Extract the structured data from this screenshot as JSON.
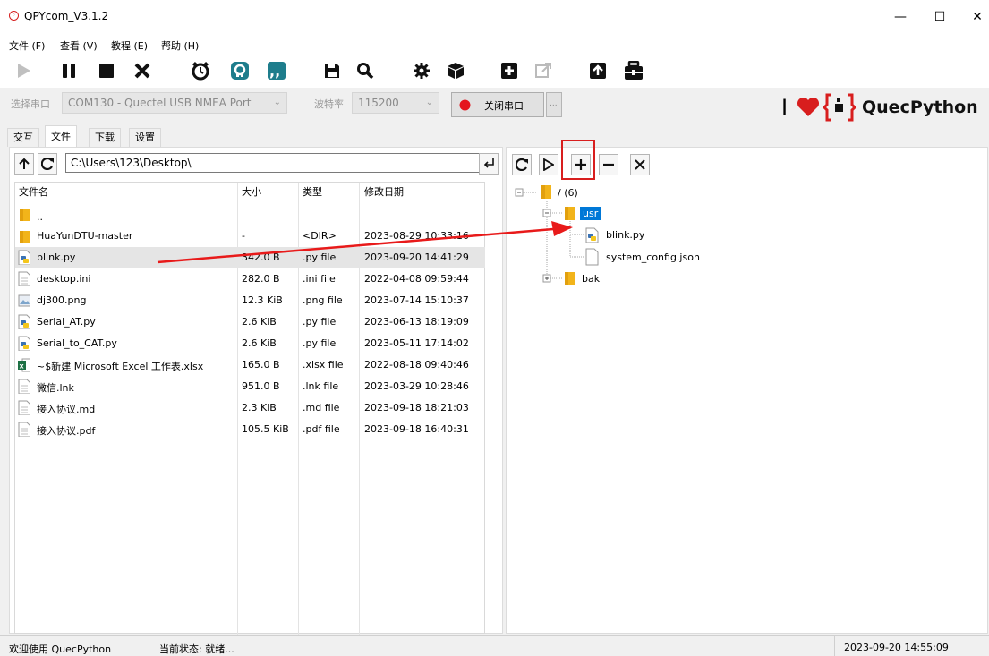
{
  "window": {
    "title": "QPYcom_V3.1.2",
    "minimize": "—",
    "maximize": "☐",
    "close": "✕"
  },
  "menu": [
    "文件 (F)",
    "查看 (V)",
    "教程 (E)",
    "帮助 (H)"
  ],
  "port": {
    "label": "选择串口",
    "value": "COM130 - Quectel USB NMEA Port",
    "baud_label": "波特率",
    "baud_value": "115200",
    "close_label": "关闭串口",
    "more": "..."
  },
  "brand": {
    "name": "QuecPython",
    "cursor": "I"
  },
  "tabs": [
    "交互",
    "文件",
    "下载",
    "设置"
  ],
  "path": "C:\\Users\\123\\Desktop\\",
  "table": {
    "headers": [
      "文件名",
      "大小",
      "类型",
      "修改日期"
    ],
    "rows": [
      {
        "name": "..",
        "size": "",
        "type": "",
        "date": "",
        "icon": "folder"
      },
      {
        "name": "HuaYunDTU-master",
        "size": "-",
        "type": "<DIR>",
        "date": "2023-08-29 10:33:16",
        "icon": "folder"
      },
      {
        "name": "blink.py",
        "size": "342.0 B",
        "type": ".py file",
        "date": "2023-09-20 14:41:29",
        "icon": "python"
      },
      {
        "name": "desktop.ini",
        "size": "282.0 B",
        "type": ".ini file",
        "date": "2022-04-08 09:59:44",
        "icon": "file"
      },
      {
        "name": "dj300.png",
        "size": "12.3 KiB",
        "type": ".png file",
        "date": "2023-07-14 15:10:37",
        "icon": "image"
      },
      {
        "name": "Serial_AT.py",
        "size": "2.6 KiB",
        "type": ".py file",
        "date": "2023-06-13 18:19:09",
        "icon": "python"
      },
      {
        "name": "Serial_to_CAT.py",
        "size": "2.6 KiB",
        "type": ".py file",
        "date": "2023-05-11 17:14:02",
        "icon": "python"
      },
      {
        "name": "~$新建 Microsoft Excel 工作表.xlsx",
        "size": "165.0 B",
        "type": ".xlsx file",
        "date": "2022-08-18 09:40:46",
        "icon": "excel"
      },
      {
        "name": "微信.lnk",
        "size": "951.0 B",
        "type": ".lnk file",
        "date": "2023-03-29 10:28:46",
        "icon": "file"
      },
      {
        "name": "接入协议.md",
        "size": "2.3 KiB",
        "type": ".md file",
        "date": "2023-09-18 18:21:03",
        "icon": "file"
      },
      {
        "name": "接入协议.pdf",
        "size": "105.5 KiB",
        "type": ".pdf file",
        "date": "2023-09-18 16:40:31",
        "icon": "file"
      }
    ]
  },
  "tree": {
    "root": "/ (6)",
    "usr": "usr",
    "blink": "blink.py",
    "config": "system_config.json",
    "bak": "bak"
  },
  "status": {
    "welcome": "欢迎使用 QuecPython",
    "state": "当前状态: 就绪...",
    "time": "2023-09-20 14:55:09"
  },
  "colors": {
    "accent": "#d81e1e",
    "selection": "#0078d7"
  }
}
